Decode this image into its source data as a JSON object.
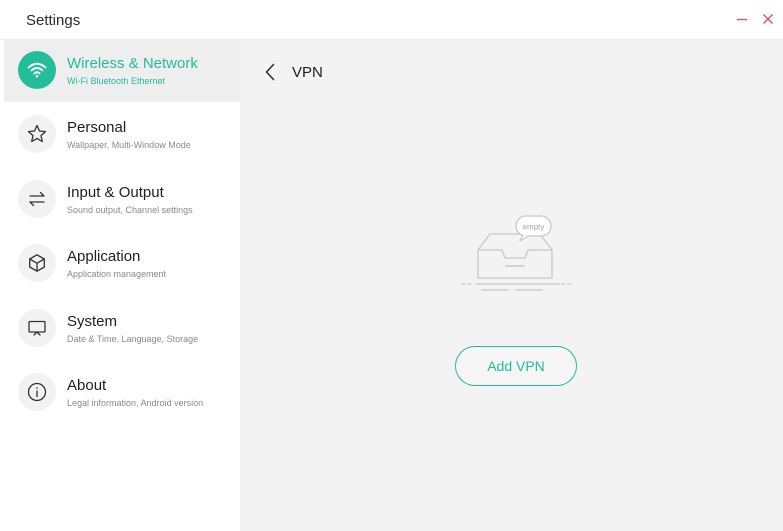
{
  "window": {
    "title": "Settings"
  },
  "sidebar": {
    "items": [
      {
        "label": "Wireless & Network",
        "subtitle": "Wi-Fi Bluetooth Ethernet",
        "icon": "wifi-icon",
        "active": true
      },
      {
        "label": "Personal",
        "subtitle": "Wallpaper, Multi-Window Mode",
        "icon": "star-icon",
        "active": false
      },
      {
        "label": "Input & Output",
        "subtitle": "Sound output, Channel settings",
        "icon": "swap-arrows-icon",
        "active": false
      },
      {
        "label": "Application",
        "subtitle": "Application management",
        "icon": "cube-icon",
        "active": false
      },
      {
        "label": "System",
        "subtitle": "Date & Time, Language, Storage",
        "icon": "monitor-icon",
        "active": false
      },
      {
        "label": "About",
        "subtitle": "Legal information, Android version",
        "icon": "info-icon",
        "active": false
      }
    ]
  },
  "main": {
    "title": "VPN",
    "empty_label": "empty",
    "add_button": "Add VPN"
  },
  "colors": {
    "accent": "#23bd99",
    "close": "#e05555",
    "content_bg": "#f3f3f3",
    "active_item_bg": "#eeeeee"
  }
}
